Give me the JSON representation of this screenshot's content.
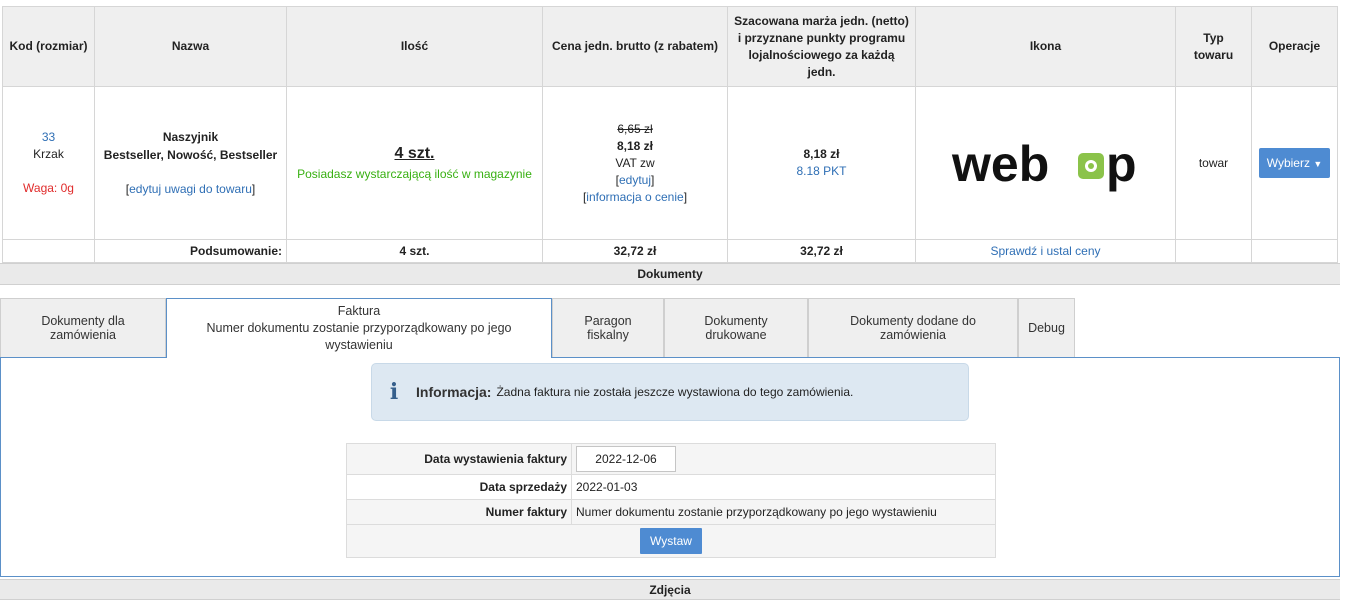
{
  "products_table": {
    "headers": [
      "Kod (rozmiar)",
      "Nazwa",
      "Ilość",
      "Cena jedn. brutto (z rabatem)",
      "Szacowana marża jedn. (netto) i przyznane punkty programu lojalnościowego za każdą jedn.",
      "Ikona",
      "Typ towaru",
      "Operacje"
    ],
    "row": {
      "code": "33",
      "size": "Krzak",
      "weight": "Waga: 0g",
      "name": "Naszyjnik",
      "tags": "Bestseller, Nowość, Bestseller",
      "edit_notes": "edytuj uwagi do towaru",
      "qty": "4 szt.",
      "stock_note": "Posiadasz wystarczającą ilość w magazynie",
      "old_price": "6,65 zł",
      "price": "8,18 zł",
      "vat": "VAT zw",
      "edit_price": "edytuj",
      "price_info": "informacja o cenie",
      "margin": "8,18 zł",
      "points": "8.18 PKT",
      "logo_text": "webop",
      "type": "towar",
      "action": "Wybierz"
    },
    "summary": {
      "label": "Podsumowanie:",
      "qty": "4 szt.",
      "price": "32,72 zł",
      "margin": "32,72 zł",
      "check_link": "Sprawdź i ustal ceny"
    }
  },
  "documents_title": "Dokumenty",
  "tabs": [
    {
      "label": "Dokumenty dla zamówienia"
    },
    {
      "label": "Faktura",
      "sub": "Numer dokumentu zostanie przyporządkowany po jego wystawieniu"
    },
    {
      "label": "Paragon fiskalny"
    },
    {
      "label": "Dokumenty drukowane"
    },
    {
      "label": "Dokumenty dodane do zamówienia"
    },
    {
      "label": "Debug"
    }
  ],
  "info": {
    "title": "Informacja:",
    "text": "Żadna faktura nie została jeszcze wystawiona do tego zamówienia."
  },
  "invoice_form": {
    "issue_date_label": "Data wystawienia faktury",
    "issue_date_value": "2022-12-06",
    "sale_date_label": "Data sprzedaży",
    "sale_date_value": "2022-01-03",
    "number_label": "Numer faktury",
    "number_value": "Numer dokumentu zostanie przyporządkowany po jego wystawieniu",
    "submit": "Wystaw"
  },
  "photos_title": "Zdjęcia",
  "colors": {
    "accent": "#4e8bd2",
    "green": "#38b012",
    "red": "#e02b2b",
    "logo_green": "#8bc34a"
  }
}
